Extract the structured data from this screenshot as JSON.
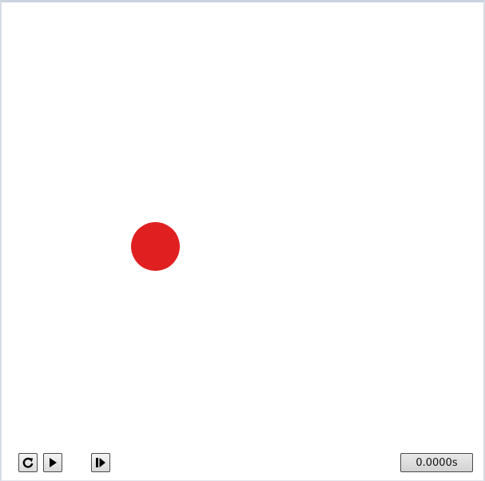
{
  "simulation": {
    "time_display": "0.0000s",
    "ball_color": "#e02020"
  },
  "controls": {
    "reset_icon": "reset-icon",
    "play_icon": "play-icon",
    "step_icon": "step-forward-icon"
  }
}
